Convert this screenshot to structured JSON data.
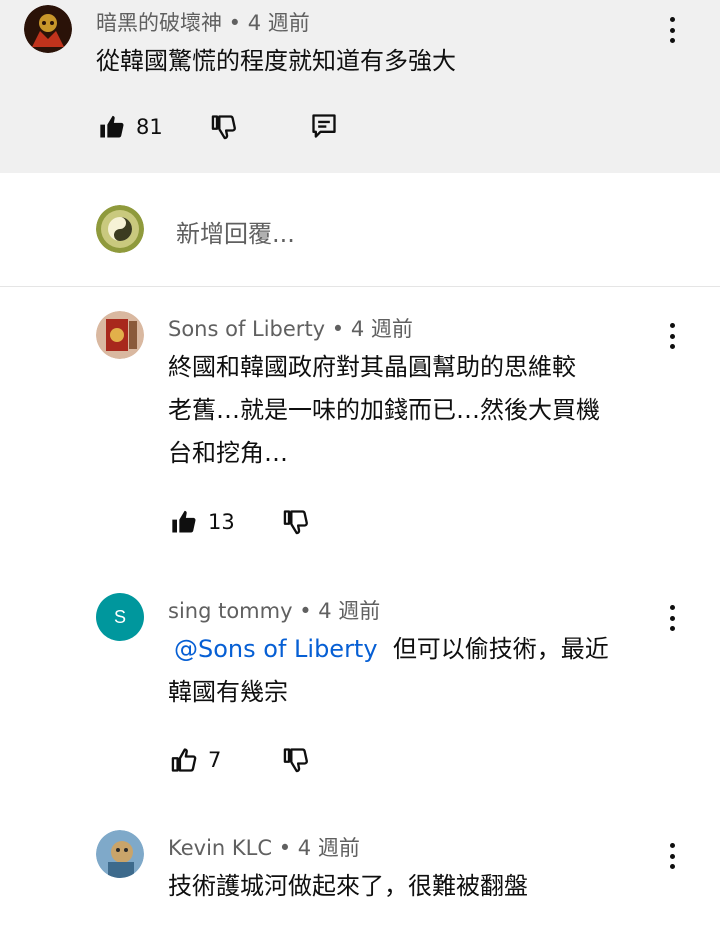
{
  "comments": [
    {
      "author": "暗黑的破壞神",
      "time": "4 週前",
      "text": "從韓國驚慌的程度就知道有多強大",
      "likes": "81"
    },
    {
      "author": "Sons of Liberty",
      "time": "4 週前",
      "lines": [
        "終國和韓國政府對其晶圓幫助的思維較",
        "老舊…就是一味的加錢而已…然後大買機",
        "台和挖角…"
      ],
      "likes": "13"
    },
    {
      "author": "sing tommy",
      "time": "4 週前",
      "avatar_letter": "S",
      "mention": "@Sons of Liberty",
      "line1_rest": "但可以偷技術，最近",
      "line2": "韓國有幾宗",
      "likes": "7"
    },
    {
      "author": "Kevin KLC",
      "time": "4 週前",
      "text": "技術護城河做起來了，很難被翻盤"
    }
  ],
  "reply_box": {
    "placeholder": "新增回覆..."
  },
  "separator": " • ",
  "colors": {
    "highlight_bg": "#f0f0f0",
    "link": "#065fd4",
    "letter_avatar": "#00979d"
  }
}
